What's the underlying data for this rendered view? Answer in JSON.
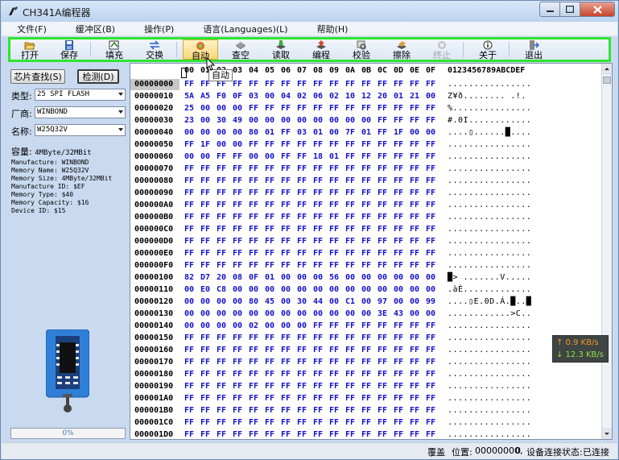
{
  "window": {
    "title": "CH341A编程器"
  },
  "menu": [
    "文件(F)",
    "缓冲区(B)",
    "操作(P)",
    "语言(Languages)(L)",
    "帮助(H)"
  ],
  "toolbar": [
    {
      "id": "open",
      "label": "打开",
      "icon": "folder-open-icon",
      "state": "normal"
    },
    {
      "id": "save",
      "label": "保存",
      "icon": "floppy-icon",
      "state": "normal"
    },
    {
      "id": "fill",
      "label": "填充",
      "icon": "fill-icon",
      "state": "normal"
    },
    {
      "id": "swap",
      "label": "交换",
      "icon": "swap-arrows-icon",
      "state": "normal"
    },
    {
      "id": "auto",
      "label": "自动",
      "icon": "auto-icon",
      "state": "active"
    },
    {
      "id": "blank",
      "label": "查空",
      "icon": "chip-check-icon",
      "state": "normal"
    },
    {
      "id": "read",
      "label": "读取",
      "icon": "chip-read-icon",
      "state": "normal"
    },
    {
      "id": "program",
      "label": "编程",
      "icon": "chip-program-icon",
      "state": "normal"
    },
    {
      "id": "verify",
      "label": "校验",
      "icon": "verify-icon",
      "state": "normal"
    },
    {
      "id": "erase",
      "label": "擦除",
      "icon": "eraser-icon",
      "state": "normal"
    },
    {
      "id": "stop",
      "label": "终止",
      "icon": "stop-icon",
      "state": "disabled"
    },
    {
      "id": "about",
      "label": "关于",
      "icon": "info-icon",
      "state": "normal"
    },
    {
      "id": "exit",
      "label": "退出",
      "icon": "exit-icon",
      "state": "normal"
    }
  ],
  "tooltip": "自动",
  "left": {
    "find_button": "芯片查找(S)",
    "detect_button": "检测(D)",
    "type_label": "类型:",
    "type_value": "25 SPI FLASH",
    "vendor_label": "厂商:",
    "vendor_value": "WINBOND",
    "name_label": "名称:",
    "name_value": "W25Q32V",
    "capacity_label": "容量:",
    "capacity_value": "4MByte/32MBit",
    "info": [
      "Manufacture: WINBOND",
      "Memory Name: W25Q32V",
      "Memory Size: 4MByte/32MBit",
      "Manufacture ID: $EF",
      "Memory Type: $40",
      "Memory Capacity: $16",
      "Device ID: $15"
    ],
    "progress_percent": 0,
    "progress_label": "0%"
  },
  "hex": {
    "columns": [
      "00",
      "01",
      "02",
      "03",
      "04",
      "05",
      "06",
      "07",
      "08",
      "09",
      "0A",
      "0B",
      "0C",
      "0D",
      "0E",
      "0F"
    ],
    "ascii_header": "0123456789ABCDEF",
    "rows": [
      {
        "addr": "00000000",
        "bytes": "FF FF FF FF FF FF FF FF FF FF FF FF FF FF FF FF",
        "ascii": "................"
      },
      {
        "addr": "00000010",
        "bytes": "5A A5 F0 0F 03 00 04 02 06 02 10 12 20 01 21 00",
        "ascii": "Z¥ð........ .!."
      },
      {
        "addr": "00000020",
        "bytes": "25 00 00 00 FF FF FF FF FF FF FF FF FF FF FF FF",
        "ascii": "%..............."
      },
      {
        "addr": "00000030",
        "bytes": "23 00 30 49 00 00 00 00 00 00 00 00 FF FF FF FF",
        "ascii": "#.0I............"
      },
      {
        "addr": "00000040",
        "bytes": "00 00 00 00 80 01 FF 03 01 00 7F 01 FF 1F 00 00",
        "ascii": "....▯......█...."
      },
      {
        "addr": "00000050",
        "bytes": "FF 1F 00 00 FF FF FF FF FF FF FF FF FF FF FF FF",
        "ascii": "................"
      },
      {
        "addr": "00000060",
        "bytes": "00 00 FF FF 00 00 FF FF 18 01 FF FF FF FF FF FF",
        "ascii": "................"
      },
      {
        "addr": "00000070",
        "bytes": "FF FF FF FF FF FF FF FF FF FF FF FF FF FF FF FF",
        "ascii": "................"
      },
      {
        "addr": "00000080",
        "bytes": "FF FF FF FF FF FF FF FF FF FF FF FF FF FF FF FF",
        "ascii": "................"
      },
      {
        "addr": "00000090",
        "bytes": "FF FF FF FF FF FF FF FF FF FF FF FF FF FF FF FF",
        "ascii": "................"
      },
      {
        "addr": "000000A0",
        "bytes": "FF FF FF FF FF FF FF FF FF FF FF FF FF FF FF FF",
        "ascii": "................"
      },
      {
        "addr": "000000B0",
        "bytes": "FF FF FF FF FF FF FF FF FF FF FF FF FF FF FF FF",
        "ascii": "................"
      },
      {
        "addr": "000000C0",
        "bytes": "FF FF FF FF FF FF FF FF FF FF FF FF FF FF FF FF",
        "ascii": "................"
      },
      {
        "addr": "000000D0",
        "bytes": "FF FF FF FF FF FF FF FF FF FF FF FF FF FF FF FF",
        "ascii": "................"
      },
      {
        "addr": "000000E0",
        "bytes": "FF FF FF FF FF FF FF FF FF FF FF FF FF FF FF FF",
        "ascii": "................"
      },
      {
        "addr": "000000F0",
        "bytes": "FF FF FF FF FF FF FF FF FF FF FF FF FF FF FF FF",
        "ascii": "................"
      },
      {
        "addr": "00000100",
        "bytes": "82 D7 20 08 0F 01 00 00 00 56 00 00 00 00 00 00",
        "ascii": "█> .......V....."
      },
      {
        "addr": "00000110",
        "bytes": "00 E0 C8 00 00 00 00 00 00 00 00 00 00 00 00 00",
        "ascii": ".àÈ............."
      },
      {
        "addr": "00000120",
        "bytes": "00 00 00 00 80 45 00 30 44 00 C1 00 97 00 00 99",
        "ascii": "....▯E.0D.Á.█..█"
      },
      {
        "addr": "00000130",
        "bytes": "00 00 00 00 00 00 00 00 00 00 00 00 3E 43 00 00",
        "ascii": "............>C.."
      },
      {
        "addr": "00000140",
        "bytes": "00 00 00 00 02 00 00 00 FF FF FF FF FF FF FF FF",
        "ascii": "................"
      },
      {
        "addr": "00000150",
        "bytes": "FF FF FF FF FF FF FF FF FF FF FF FF FF FF FF FF",
        "ascii": "................"
      },
      {
        "addr": "00000160",
        "bytes": "FF FF FF FF FF FF FF FF FF FF FF FF FF FF FF FF",
        "ascii": "................"
      },
      {
        "addr": "00000170",
        "bytes": "FF FF FF FF FF FF FF FF FF FF FF FF FF FF FF FF",
        "ascii": "................"
      },
      {
        "addr": "00000180",
        "bytes": "FF FF FF FF FF FF FF FF FF FF FF FF FF FF FF FF",
        "ascii": "................"
      },
      {
        "addr": "00000190",
        "bytes": "FF FF FF FF FF FF FF FF FF FF FF FF FF FF FF FF",
        "ascii": "................"
      },
      {
        "addr": "000001A0",
        "bytes": "FF FF FF FF FF FF FF FF FF FF FF FF FF FF FF FF",
        "ascii": "................"
      },
      {
        "addr": "000001B0",
        "bytes": "FF FF FF FF FF FF FF FF FF FF FF FF FF FF FF FF",
        "ascii": "................"
      },
      {
        "addr": "000001C0",
        "bytes": "FF FF FF FF FF FF FF FF FF FF FF FF FF FF FF FF",
        "ascii": "................"
      },
      {
        "addr": "000001D0",
        "bytes": "FF FF FF FF FF FF FF FF FF FF FF FF FF FF FF FF",
        "ascii": "................"
      }
    ]
  },
  "speed": {
    "up": "↑ 0.9 KB/s",
    "down": "↓ 12.3 KB/s"
  },
  "status": {
    "mode": "覆盖",
    "position_label": "位置:",
    "position_value": "00000000,",
    "position_extra": "0",
    "connection_label": "设备连接状态:",
    "connection_value": "已连接"
  },
  "colors": {
    "toolbar_highlight": "#2ee52e",
    "hex_bytes": "#1010cc",
    "selection": "#c8c8c8"
  }
}
